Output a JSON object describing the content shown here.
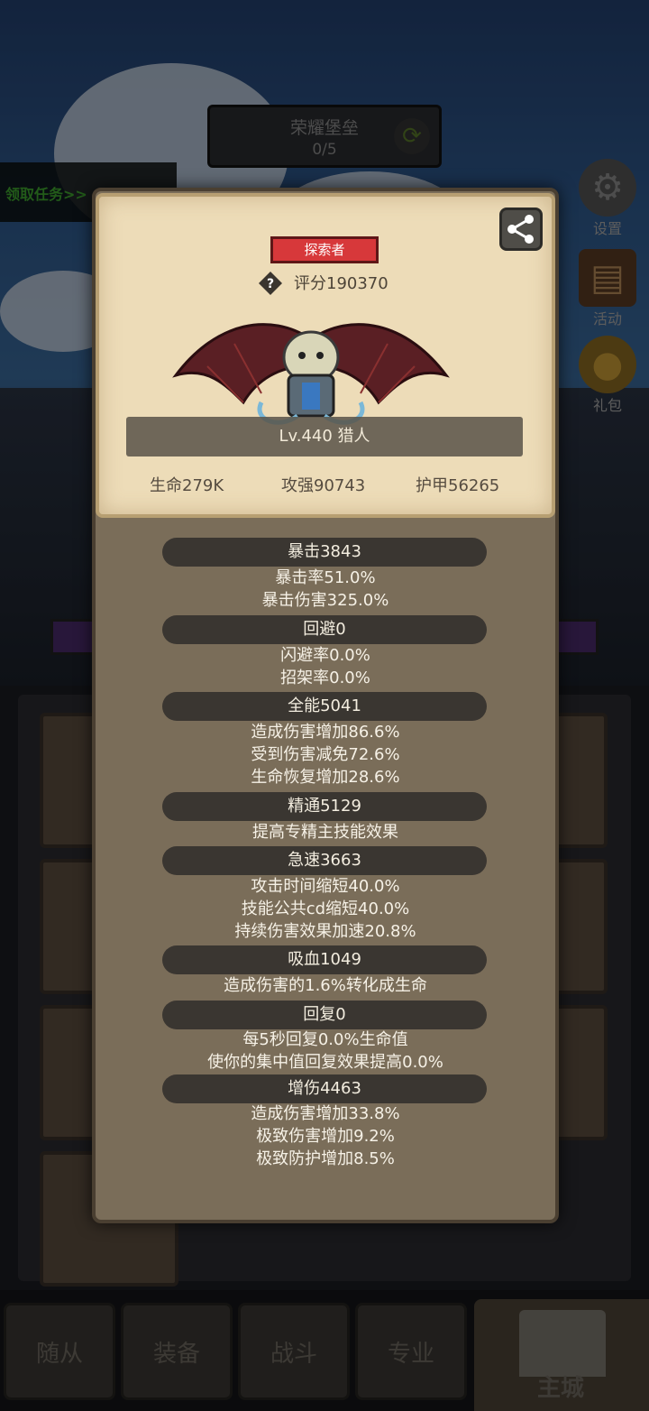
{
  "quest": {
    "title": "荣耀堡垒",
    "progress": "0/5"
  },
  "task_link": "领取任务>>",
  "side_buttons": {
    "settings": "设置",
    "activity": "活动",
    "gift": "礼包"
  },
  "card": {
    "class_badge": "探索者",
    "score": "评分190370",
    "name_level": "Lv.440 猎人",
    "stats": {
      "hp": "生命279K",
      "atk": "攻强90743",
      "armor": "护甲56265"
    }
  },
  "attributes": [
    {
      "head": "暴击3843",
      "lines": [
        "暴击率51.0%",
        "暴击伤害325.0%"
      ]
    },
    {
      "head": "回避0",
      "lines": [
        "闪避率0.0%",
        "招架率0.0%"
      ]
    },
    {
      "head": "全能5041",
      "lines": [
        "造成伤害增加86.6%",
        "受到伤害减免72.6%",
        "生命恢复增加28.6%"
      ]
    },
    {
      "head": "精通5129",
      "lines": [
        "提高专精主技能效果"
      ]
    },
    {
      "head": "急速3663",
      "lines": [
        "攻击时间缩短40.0%",
        "技能公共cd缩短40.0%",
        "持续伤害效果加速20.8%"
      ]
    },
    {
      "head": "吸血1049",
      "lines": [
        "造成伤害的1.6%转化成生命"
      ]
    },
    {
      "head": "回复0",
      "lines": [
        "每5秒回复0.0%生命值",
        "使你的集中值回复效果提高0.0%"
      ]
    },
    {
      "head": "增伤4463",
      "lines": [
        "造成伤害增加33.8%",
        "极致伤害增加9.2%",
        "极致防护增加8.5%"
      ]
    }
  ],
  "bottom_nav": {
    "followers": "随从",
    "equipment": "装备",
    "battle": "战斗",
    "profession": "专业",
    "main_city": "主城"
  },
  "colors": {
    "badge_red": "#d7383a",
    "task_green": "#3fa62f",
    "card_bg": "#eddcb8",
    "panel_bg": "#7a6d59"
  }
}
